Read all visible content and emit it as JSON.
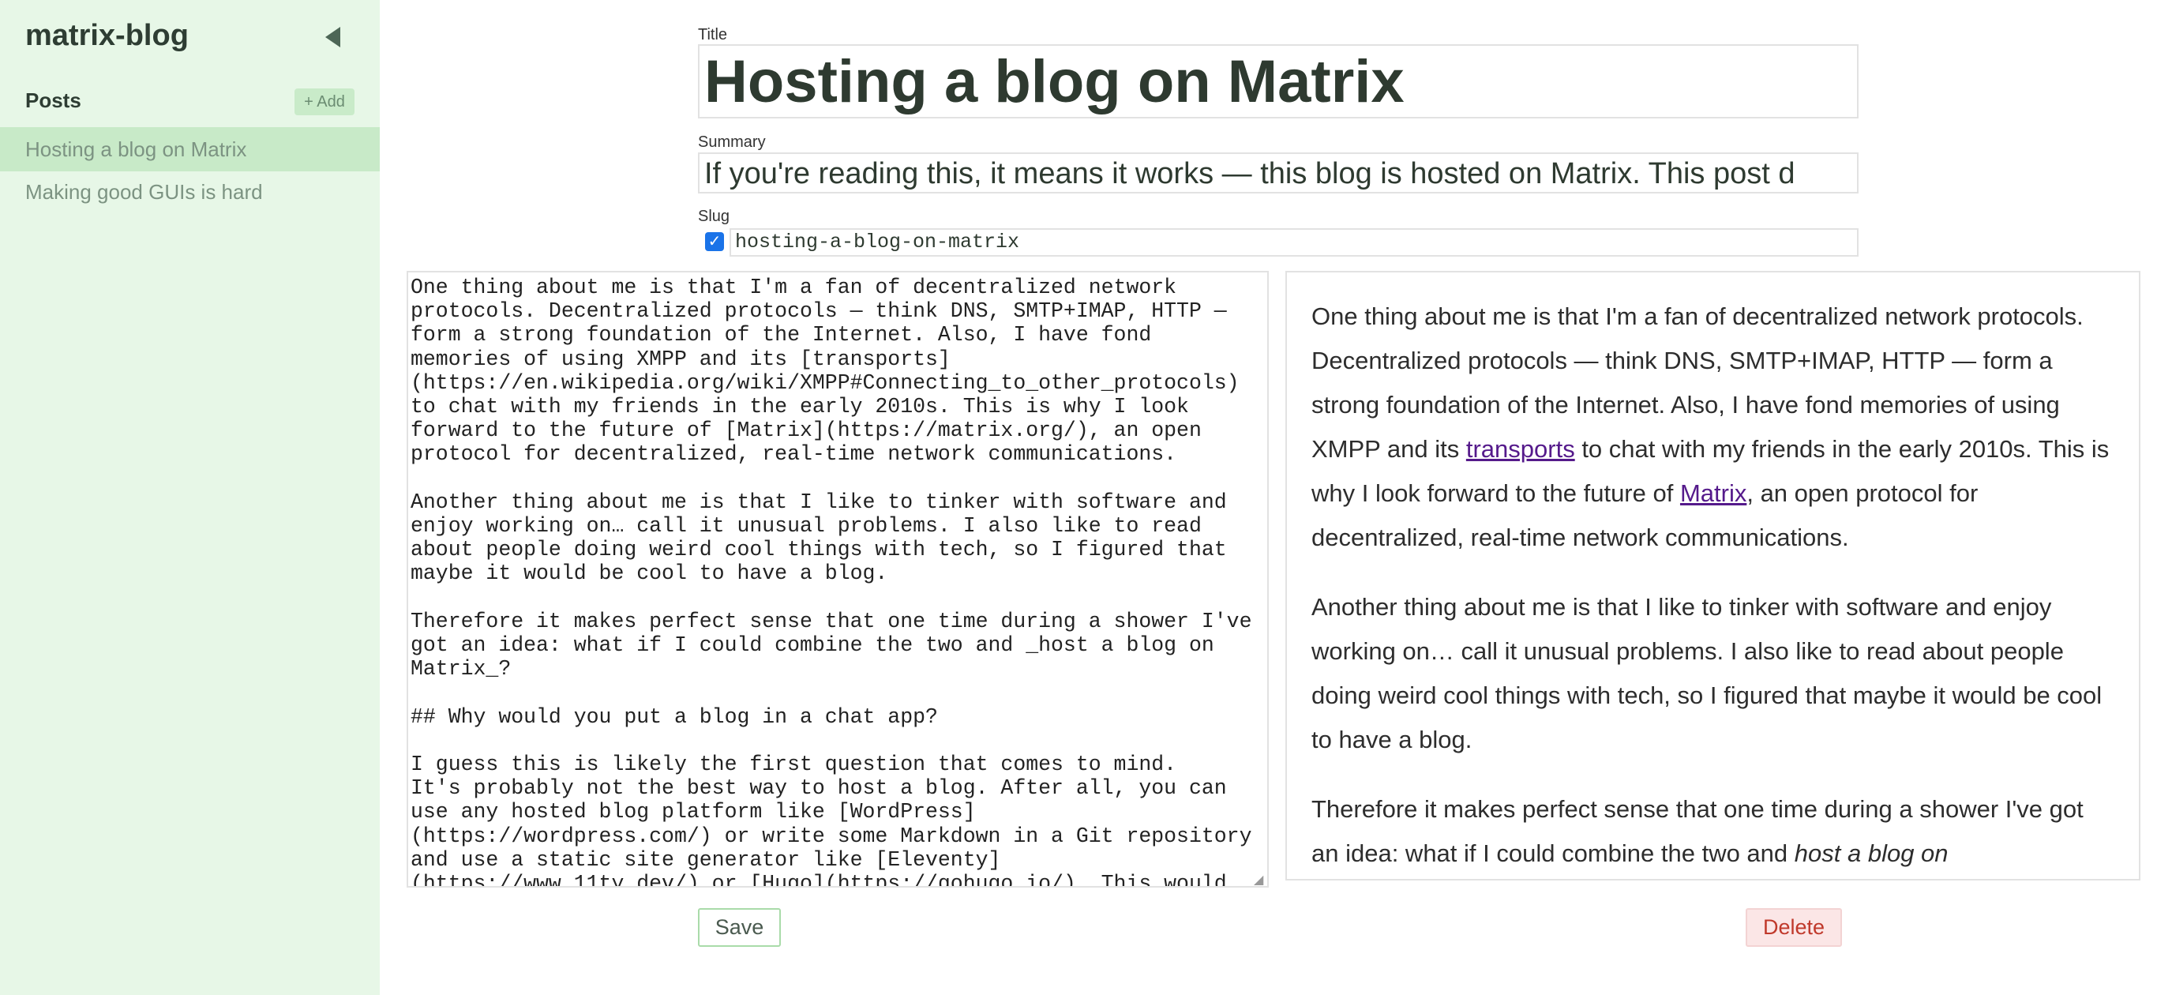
{
  "sidebar": {
    "app_title": "matrix-blog",
    "collapse_icon": "triangle-left-icon",
    "posts_heading": "Posts",
    "add_label": "+ Add",
    "items": [
      {
        "label": "Hosting a blog on Matrix",
        "selected": true
      },
      {
        "label": "Making good GUIs is hard",
        "selected": false
      }
    ]
  },
  "form": {
    "title_label": "Title",
    "title_value": "Hosting a blog on Matrix",
    "summary_label": "Summary",
    "summary_value": "If you're reading this, it means it works — this blog is hosted on Matrix. This post d",
    "slug_label": "Slug",
    "slug_auto_checked": true,
    "slug_value": "hosting-a-blog-on-matrix"
  },
  "editor": {
    "content": "One thing about me is that I'm a fan of decentralized network\nprotocols. Decentralized protocols — think DNS, SMTP+IMAP, HTTP —\nform a strong foundation of the Internet. Also, I have fond\nmemories of using XMPP and its [transports]\n(https://en.wikipedia.org/wiki/XMPP#Connecting_to_other_protocols)\nto chat with my friends in the early 2010s. This is why I look\nforward to the future of [Matrix](https://matrix.org/), an open\nprotocol for decentralized, real-time network communications.\n\nAnother thing about me is that I like to tinker with software and\nenjoy working on… call it unusual problems. I also like to read\nabout people doing weird cool things with tech, so I figured that\nmaybe it would be cool to have a blog.\n\nTherefore it makes perfect sense that one time during a shower I've\ngot an idea: what if I could combine the two and _host a blog on\nMatrix_?\n\n## Why would you put a blog in a chat app?\n\nI guess this is likely the first question that comes to mind.\nIt's probably not the best way to host a blog. After all, you can\nuse any hosted blog platform like [WordPress]\n(https://wordpress.com/) or write some Markdown in a Git repository\nand use a static site generator like [Eleventy]\n(https://www.11ty.dev/) or [Hugo](https://gohugo.io/). This would"
  },
  "preview": {
    "p1_a": "One thing about me is that I'm a fan of decentralized network protocols. Decentralized protocols — think DNS, SMTP+IMAP, HTTP — form a strong foundation of the Internet. Also, I have fond memories of using XMPP and its ",
    "p1_link1": "transports",
    "p1_b": " to chat with my friends in the early 2010s. This is why I look forward to the future of ",
    "p1_link2": "Matrix",
    "p1_c": ", an open protocol for decentralized, real-time network communications.",
    "p2": "Another thing about me is that I like to tinker with software and enjoy working on… call it unusual problems. I also like to read about people doing weird cool things with tech, so I figured that maybe it would be cool to have a blog.",
    "p3_a": "Therefore it makes perfect sense that one time during a shower I've got an idea: what if I could combine the two and ",
    "p3_em": "host a blog on"
  },
  "actions": {
    "save_label": "Save",
    "delete_label": "Delete"
  },
  "colors": {
    "sidebar_bg": "#e7f7e7",
    "selected_bg": "#c8eac8",
    "link": "#551a8b",
    "delete": "#c0392b",
    "checkbox": "#1a73e8"
  }
}
